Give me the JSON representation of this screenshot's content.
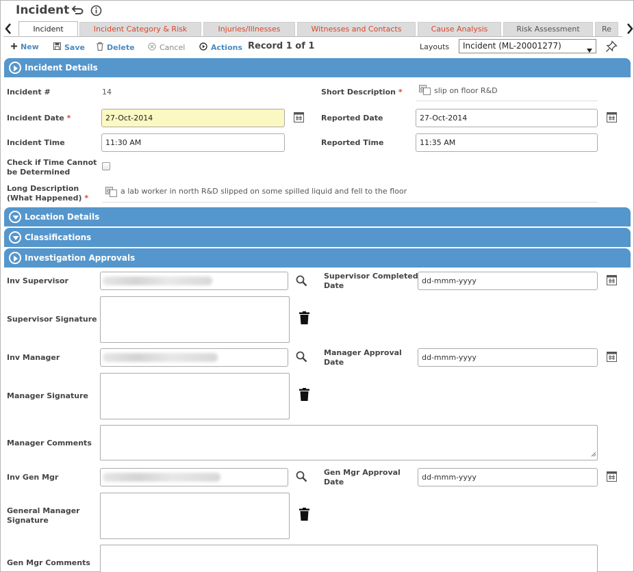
{
  "header": {
    "title": "Incident"
  },
  "tabs": [
    {
      "label": "Incident"
    },
    {
      "label": "Incident Category & Risk"
    },
    {
      "label": "Injuries/Illnesses"
    },
    {
      "label": "Witnesses and Contacts"
    },
    {
      "label": "Cause Analysis"
    },
    {
      "label": "Risk Assessment"
    },
    {
      "label": "Re"
    }
  ],
  "toolbar": {
    "new": "New",
    "save": "Save",
    "delete": "Delete",
    "cancel": "Cancel",
    "actions": "Actions",
    "record": "Record 1 of 1",
    "layouts_label": "Layouts",
    "layout_value": "Incident (ML-20001277)"
  },
  "sections": {
    "incident_details": "Incident Details",
    "location_details": "Location Details",
    "classifications": "Classifications",
    "investigation_approvals": "Investigation Approvals"
  },
  "incident": {
    "number_label": "Incident #",
    "number_value": "14",
    "short_desc_label": "Short Description",
    "short_desc_value": "slip on floor R&D",
    "date_label": "Incident Date",
    "date_value": "27-Oct-2014",
    "reported_date_label": "Reported Date",
    "reported_date_value": "27-Oct-2014",
    "time_label": "Incident Time",
    "time_value": "11:30 AM",
    "reported_time_label": "Reported Time",
    "reported_time_value": "11:35 AM",
    "time_undetermined_label_1": "Check if Time Cannot",
    "time_undetermined_label_2": "be Determined",
    "long_desc_label_1": "Long Description",
    "long_desc_label_2": "(What Happened)",
    "long_desc_value": "a lab worker in north R&D slipped on some spilled liquid and fell to the floor"
  },
  "approvals": {
    "inv_supervisor_label": "Inv Supervisor",
    "sup_completed_label_1": "Supervisor Completed",
    "sup_completed_label_2": "Date",
    "sup_completed_ph": "dd-mmm-yyyy",
    "sup_signature_label": "Supervisor Signature",
    "inv_manager_label": "Inv Manager",
    "mgr_approval_label_1": "Manager Approval",
    "mgr_approval_label_2": "Date",
    "mgr_approval_ph": "dd-mmm-yyyy",
    "mgr_signature_label": "Manager Signature",
    "mgr_comments_label": "Manager Comments",
    "inv_gen_mgr_label": "Inv Gen Mgr",
    "gen_mgr_approval_label_1": "Gen Mgr Approval",
    "gen_mgr_approval_label_2": "Date",
    "gen_mgr_approval_ph": "dd-mmm-yyyy",
    "gm_signature_label_1": "General Manager",
    "gm_signature_label_2": "Signature",
    "gm_comments_label": "Gen Mgr Comments"
  },
  "colors": {
    "accent": "#5596cc",
    "tab_text": "#d9442c",
    "required": "#d9442c",
    "highlight": "#fbf8c2"
  }
}
